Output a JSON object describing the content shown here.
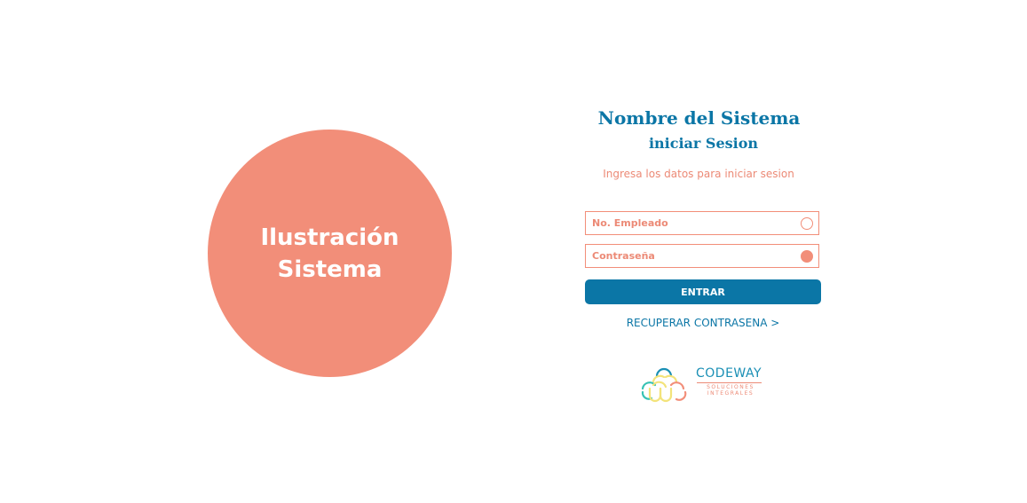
{
  "illustration": {
    "line1": "Ilustración",
    "line2": "Sistema"
  },
  "header": {
    "title": "Nombre del Sistema",
    "subtitle": "iniciar Sesion",
    "hint": "Ingresa los datos para iniciar sesion"
  },
  "form": {
    "employee_placeholder": "No. Empleado",
    "employee_value": "",
    "password_placeholder": "Contraseña",
    "password_value": "",
    "submit_label": "ENTRAR",
    "recover_label": "RECUPERAR CONTRASENA >"
  },
  "logo": {
    "name": "CODEWAY",
    "tagline_line1": "SOLUCIONES",
    "tagline_line2": "INTEGRALES"
  },
  "colors": {
    "primary_blue": "#0b76a6",
    "accent_salmon": "#f28e79",
    "logo_yellow": "#f3e37a",
    "logo_teal": "#36c2b4",
    "logo_blue": "#1a8fb5"
  },
  "icons": {
    "employee_field": "circle-outline-icon",
    "password_field": "circle-filled-icon"
  }
}
